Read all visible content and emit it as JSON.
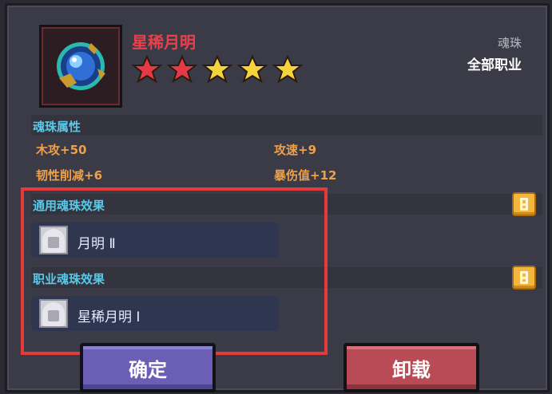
{
  "item": {
    "name": "星稀月明",
    "type_label": "魂珠",
    "class_label": "全部职业",
    "stars": [
      {
        "color": "#e63946",
        "icon": "star-icon"
      },
      {
        "color": "#e63946",
        "icon": "star-icon"
      },
      {
        "color": "#f5d33a",
        "icon": "star-icon"
      },
      {
        "color": "#f5d33a",
        "icon": "star-icon"
      },
      {
        "color": "#f5d33a",
        "icon": "star-icon"
      }
    ],
    "icon": "soul-gem-icon"
  },
  "attributes": {
    "title": "魂珠属性",
    "list": [
      {
        "text": "木攻+50"
      },
      {
        "text": "攻速+9"
      },
      {
        "text": "韧性削减+6"
      },
      {
        "text": "暴伤值+12"
      }
    ]
  },
  "general_effect": {
    "title": "通用魂珠效果",
    "effect_label": "月明 Ⅱ"
  },
  "class_effect": {
    "title": "职业魂珠效果",
    "effect_label": "星稀月明 Ⅰ"
  },
  "buttons": {
    "confirm": "确定",
    "unload": "卸载"
  },
  "colors": {
    "name": "#e8414b",
    "section_title": "#58c8e8",
    "attribute": "#f0a048",
    "highlight_border": "#e63a3a"
  }
}
